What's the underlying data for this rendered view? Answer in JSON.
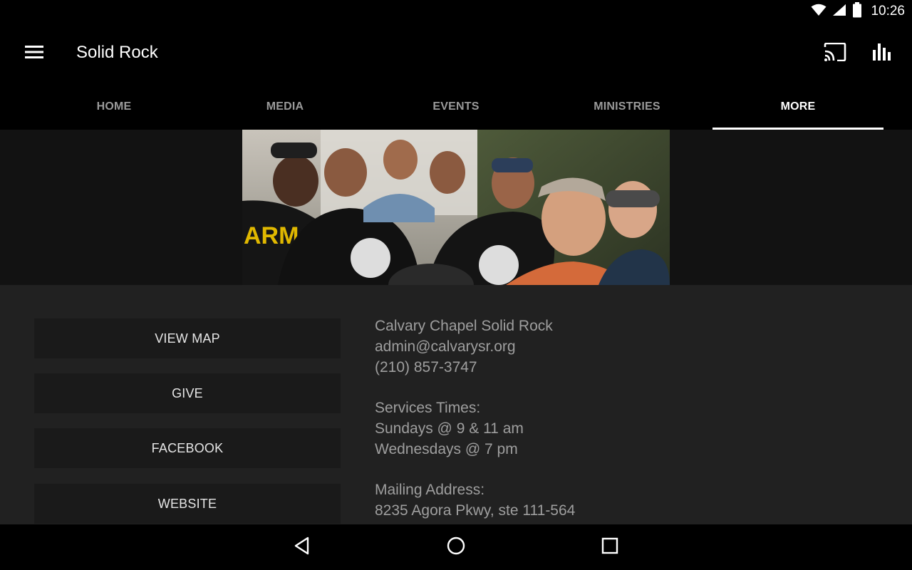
{
  "status_bar": {
    "time": "10:26",
    "icons": [
      "wifi-icon",
      "cell-signal-icon",
      "battery-icon"
    ]
  },
  "app_bar": {
    "title": "Solid Rock",
    "icons": [
      "menu-icon",
      "cast-icon",
      "bar-chart-icon"
    ]
  },
  "tabs": [
    {
      "label": "HOME",
      "active": false
    },
    {
      "label": "MEDIA",
      "active": false
    },
    {
      "label": "EVENTS",
      "active": false
    },
    {
      "label": "MINISTRIES",
      "active": false
    },
    {
      "label": "MORE",
      "active": true
    }
  ],
  "actions": [
    {
      "label": "VIEW MAP"
    },
    {
      "label": "GIVE"
    },
    {
      "label": "FACEBOOK"
    },
    {
      "label": "WEBSITE"
    }
  ],
  "info": {
    "church_name": "Calvary Chapel Solid Rock",
    "email": "admin@calvarysr.org",
    "phone": "(210) 857-3747",
    "services_heading": "Services Times:",
    "services_sunday": "Sundays @ 9 & 11 am",
    "services_wednesday": "Wednesdays @ 7 pm",
    "mailing_heading": "Mailing Address:",
    "mailing_address": "8235 Agora Pkwy, ste 111-564"
  },
  "nav_bar": {
    "icons": [
      "back-icon",
      "home-icon",
      "recents-icon"
    ]
  },
  "colors": {
    "background": "#000000",
    "content_background": "#212121",
    "button_background": "#1a1a1a",
    "info_text": "#9e9e9e",
    "tab_inactive": "#9a9a9a",
    "tab_active": "#ffffff"
  }
}
